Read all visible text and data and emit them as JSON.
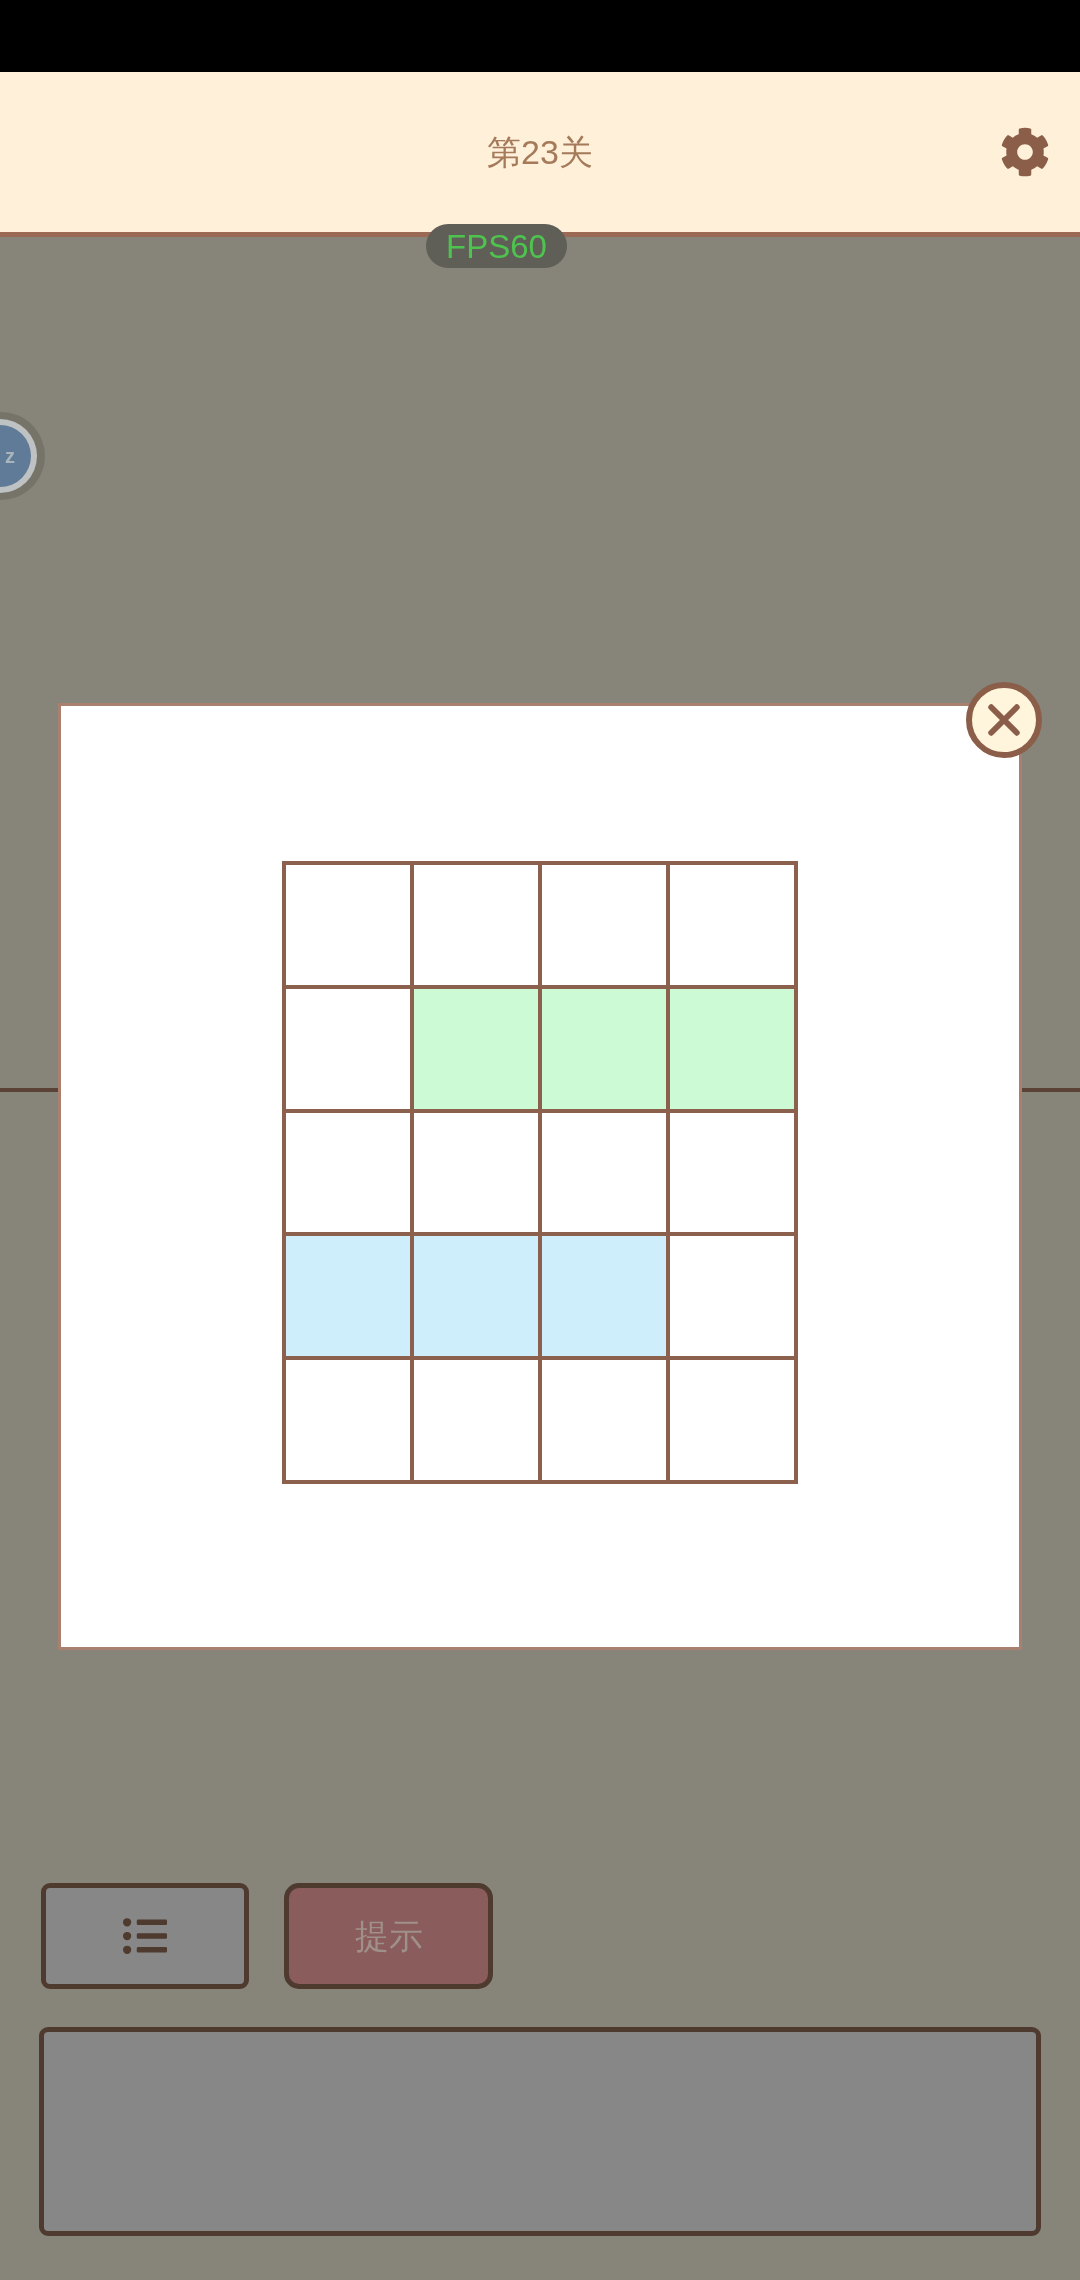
{
  "header": {
    "title": "第23关"
  },
  "fps_badge": {
    "text": "FPS60"
  },
  "side_badge": {
    "text": "z"
  },
  "dialog": {
    "grid": {
      "rows": [
        {
          "cells": [
            {
              "color": "#ffffff"
            },
            {
              "color": "#ffffff"
            },
            {
              "color": "#ffffff"
            },
            {
              "color": "#ffffff"
            }
          ]
        },
        {
          "cells": [
            {
              "color": "#ffffff"
            },
            {
              "color": "#ccfad4"
            },
            {
              "color": "#ccfad4"
            },
            {
              "color": "#ccfad4"
            }
          ]
        },
        {
          "cells": [
            {
              "color": "#ffffff"
            },
            {
              "color": "#ffffff"
            },
            {
              "color": "#ffffff"
            },
            {
              "color": "#ffffff"
            }
          ]
        },
        {
          "cells": [
            {
              "color": "#cfeefc"
            },
            {
              "color": "#cfeefc"
            },
            {
              "color": "#cfeefc"
            },
            {
              "color": "#ffffff"
            }
          ]
        },
        {
          "cells": [
            {
              "color": "#ffffff"
            },
            {
              "color": "#ffffff"
            },
            {
              "color": "#ffffff"
            },
            {
              "color": "#ffffff"
            }
          ]
        }
      ]
    }
  },
  "toolbar": {
    "hint_button": {
      "label": "提示"
    }
  }
}
